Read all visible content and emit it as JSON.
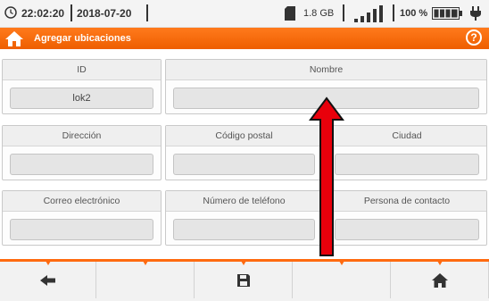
{
  "status_bar": {
    "time": "22:02:20",
    "date": "2018-07-20",
    "storage": "1.8 GB",
    "battery": "100 %",
    "icons": [
      "clock-icon",
      "sd-card-icon",
      "signal-icon",
      "battery-icon",
      "plug-icon"
    ]
  },
  "title_bar": {
    "title": "Agregar ubicaciones",
    "help": "?",
    "accent_color": "#f26a10"
  },
  "form": {
    "id": {
      "label": "ID",
      "value": "lok2"
    },
    "nombre": {
      "label": "Nombre",
      "value": ""
    },
    "direccion": {
      "label": "Dirección",
      "value": ""
    },
    "codigo_postal": {
      "label": "Código postal",
      "value": ""
    },
    "ciudad": {
      "label": "Ciudad",
      "value": ""
    },
    "correo": {
      "label": "Correo electrónico",
      "value": ""
    },
    "telefono": {
      "label": "Número de teléfono",
      "value": ""
    },
    "contacto": {
      "label": "Persona de contacto",
      "value": ""
    }
  },
  "bottom_nav": {
    "buttons": [
      "back-arrow-icon",
      "",
      "save-icon",
      "",
      "home-icon"
    ]
  }
}
